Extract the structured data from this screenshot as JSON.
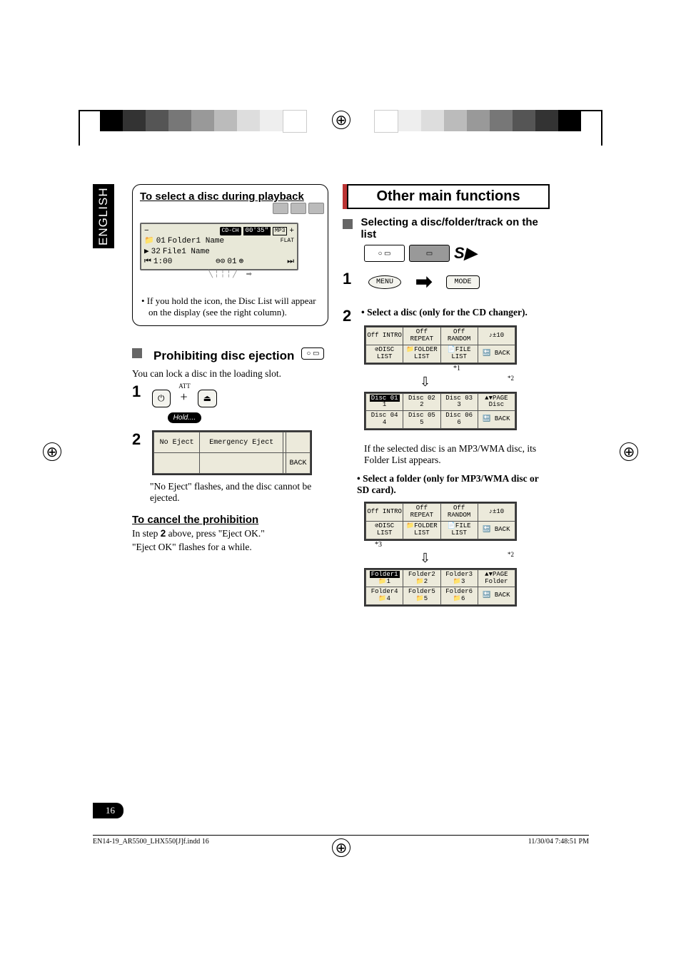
{
  "lang_tab": "ENGLISH",
  "left": {
    "select_heading": "To select a disc during playback",
    "lcd": {
      "badge": "CD-CH",
      "time": "00'35\"",
      "mp3": "MP3",
      "line1_a": "01",
      "line1_b": "Folder1 Name",
      "flat": "FLAT",
      "line2_a": "32",
      "line2_b": "File1 Name",
      "line3_a": "1:00",
      "line3_b": "01"
    },
    "note1": "• If you hold the icon, the Disc List will appear on the display (see the right column).",
    "h2": "Prohibiting disc ejection",
    "src_box": "○ ▭",
    "body1": "You can lock a disc in the loading slot.",
    "att": "ATT",
    "plus": "+",
    "hold": "Hold....",
    "grid": {
      "a": "No Eject",
      "b": "Emergency Eject",
      "back": "BACK"
    },
    "body2": "\"No Eject\" flashes, and the disc cannot be ejected.",
    "cancel_h": "To cancel the prohibition",
    "cancel_1a": "In step ",
    "cancel_1b": "2",
    "cancel_1c": " above, press \"Eject OK.\"",
    "cancel_2": "\"Eject OK\" flashes for a while."
  },
  "right": {
    "title": "Other main functions",
    "h2": "Selecting a disc/folder/track on the list",
    "menu": "MENU",
    "mode": "MODE",
    "arrow": "➡",
    "step2a": "• Select a disc (only for the CD changer).",
    "grid1_r1": [
      "Off INTRO",
      "Off REPEAT",
      "Off RANDOM",
      "♪±10"
    ],
    "grid1_r2": [
      "⊘DISC LIST",
      "📁FOLDER LIST",
      "📄FILE LIST",
      "🔙 BACK"
    ],
    "star1": "*1",
    "star2": "*2",
    "grid1b_r1": [
      "Disc 01",
      "Disc 02",
      "Disc 03",
      "▲▼PAGE Disc"
    ],
    "grid1b_r1_sub": [
      "1",
      "2",
      "3",
      ""
    ],
    "grid1b_r2": [
      "Disc 04",
      "Disc 05",
      "Disc 06",
      "🔙 BACK"
    ],
    "grid1b_r2_sub": [
      "4",
      "5",
      "6",
      ""
    ],
    "mp3_note": "If the selected disc is an MP3/WMA disc, its Folder List appears.",
    "step2b": "• Select a folder (only for MP3/WMA disc or SD card).",
    "star3": "*3",
    "grid2b_r1": [
      "Folder1",
      "Folder2",
      "Folder3",
      "▲▼PAGE Folder"
    ],
    "grid2b_r1_sub": [
      "📁1",
      "📁2",
      "📁3",
      ""
    ],
    "grid2b_r2": [
      "Folder4",
      "Folder5",
      "Folder6",
      "🔙 BACK"
    ],
    "grid2b_r2_sub": [
      "📁4",
      "📁5",
      "📁6",
      ""
    ]
  },
  "page_num": "16",
  "footer_left": "EN14-19_AR5500_LHX550[J]f.indd   16",
  "footer_right": "11/30/04   7:48:51 PM",
  "steps": {
    "one": "1",
    "two": "2"
  },
  "sd": "S▶"
}
